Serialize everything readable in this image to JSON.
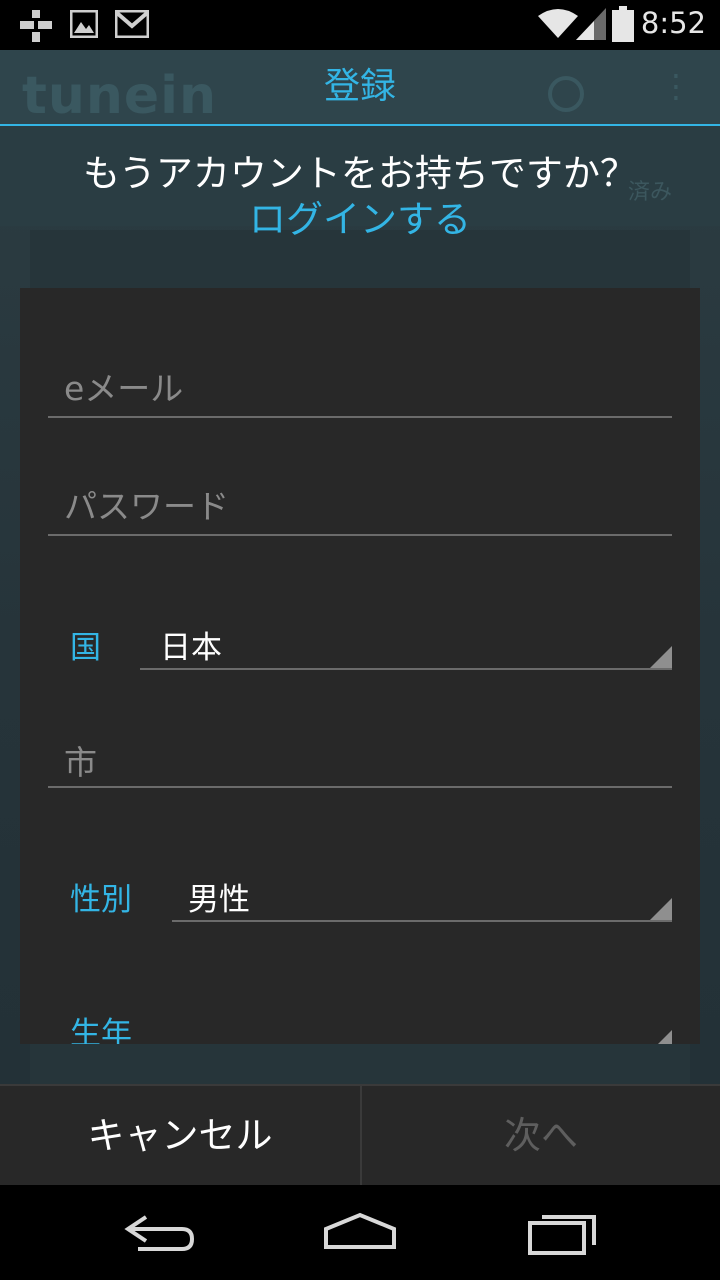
{
  "status_bar": {
    "time": "8:52",
    "left_icons": [
      "tunein-notification-icon",
      "image-icon",
      "gmail-icon"
    ],
    "right_icons": [
      "wifi-icon",
      "signal-icon",
      "battery-icon"
    ]
  },
  "background_app": {
    "logo": "tunein",
    "tab_fragment": "済み"
  },
  "dialog": {
    "title": "登録",
    "question": "もうアカウントをお持ちですか？",
    "login_link": "ログインする",
    "email_placeholder": "eメール",
    "password_placeholder": "パスワード",
    "country_label": "国",
    "country_value": "日本",
    "city_placeholder": "市",
    "gender_label": "性別",
    "gender_value": "男性",
    "birth_year_label": "生年",
    "cancel_label": "キャンセル",
    "next_label": "次へ"
  },
  "colors": {
    "accent": "#33b5e5",
    "panel": "#282828",
    "disabled_text": "#5e5e5e"
  },
  "nav_bar": {
    "icons": [
      "back-icon",
      "home-icon",
      "recent-apps-icon"
    ]
  }
}
